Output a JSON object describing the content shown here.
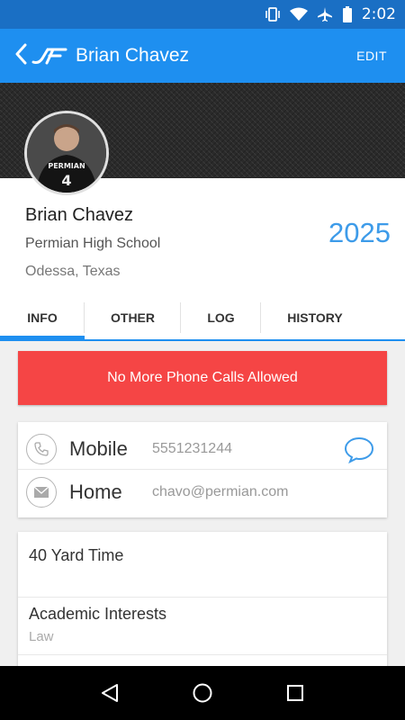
{
  "status_bar": {
    "time": "2:02",
    "icons": [
      "vibrate-icon",
      "wifi-icon",
      "airplane-icon",
      "battery-icon"
    ]
  },
  "app_bar": {
    "title": "Brian Chavez",
    "edit_label": "EDIT",
    "color": "#1e8ff0"
  },
  "profile": {
    "name": "Brian Chavez",
    "school": "Permian High School",
    "location": "Odessa, Texas",
    "year": "2025",
    "year_color": "#3d9be9"
  },
  "tabs": [
    {
      "label": "INFO",
      "active": true
    },
    {
      "label": "OTHER",
      "active": false
    },
    {
      "label": "LOG",
      "active": false
    },
    {
      "label": "HISTORY",
      "active": false
    }
  ],
  "alert": {
    "label": "No More Phone Calls Allowed",
    "color": "#f54545"
  },
  "contacts": [
    {
      "type": "Mobile",
      "value": "5551231244",
      "icon": "phone-icon"
    },
    {
      "type": "Home",
      "value": "chavo@permian.com",
      "icon": "email-icon"
    }
  ],
  "info": [
    {
      "label": "40 Yard Time",
      "value": ""
    },
    {
      "label": "Academic Interests",
      "value": "Law"
    }
  ]
}
